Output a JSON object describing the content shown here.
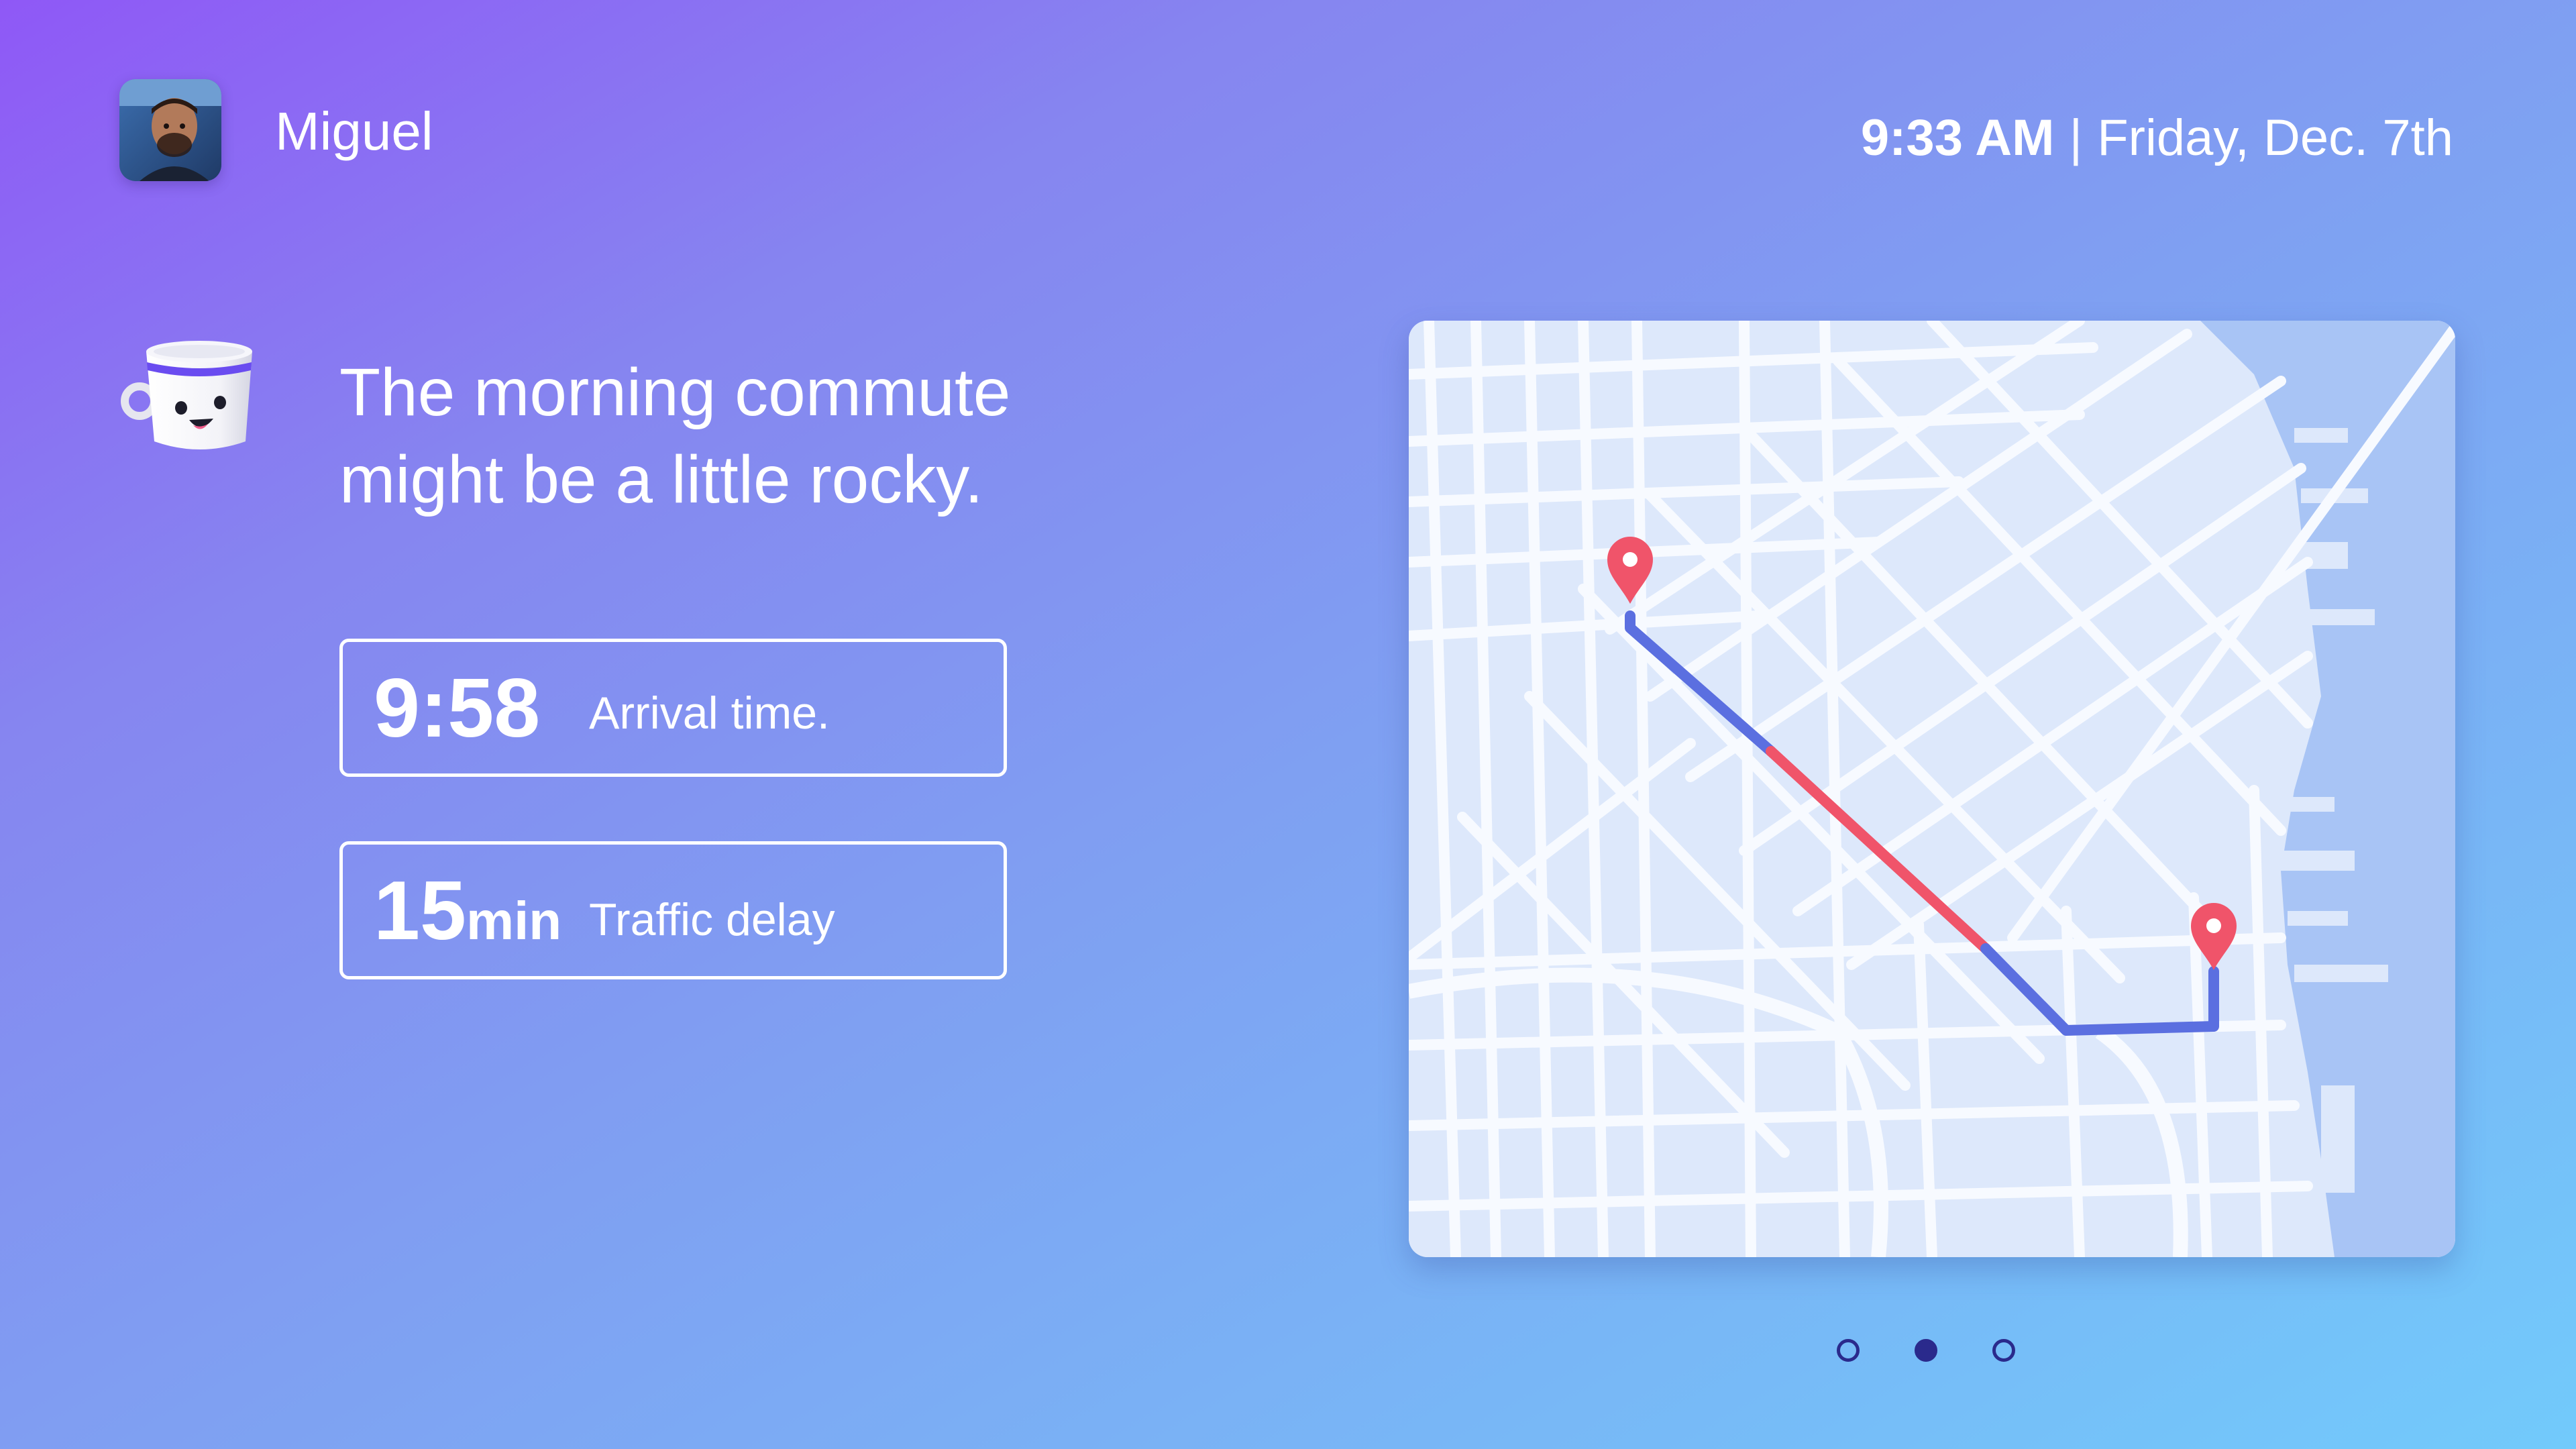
{
  "header": {
    "user_name": "Miguel",
    "time": "9:33 AM",
    "separator": "|",
    "date": "Friday, Dec. 7th"
  },
  "message": {
    "line1": "The morning commute",
    "line2": "might be a little rocky."
  },
  "stats": [
    {
      "value": "9:58",
      "unit": "",
      "label": "Arrival time."
    },
    {
      "value": "15",
      "unit": "min",
      "label": "Traffic delay"
    }
  ],
  "map": {
    "route_colors": {
      "clear": "#5b6fe0",
      "traffic": "#f0546a"
    },
    "pin_color": "#f0546a",
    "water_color": "#a8c4f5",
    "land_color": "#dde8fb",
    "road_color": "#f7faff"
  },
  "pagination": {
    "total": 3,
    "current": 2
  },
  "icons": {
    "avatar": "user-avatar-photo",
    "mascot": "coffee-cup-mascot-icon",
    "pin": "map-pin-icon"
  }
}
